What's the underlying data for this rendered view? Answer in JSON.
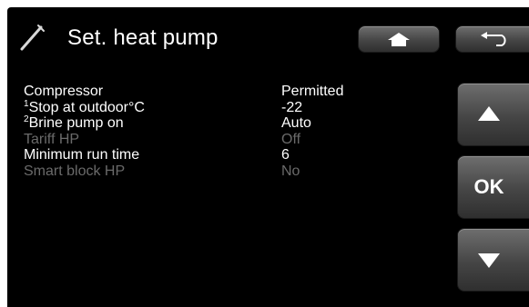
{
  "header": {
    "title": "Set. heat pump",
    "icon": "wrench-icon"
  },
  "nav_buttons": {
    "home_icon": "home-icon",
    "back_icon": "back-arrow-icon",
    "up_icon": "up-arrow-icon",
    "ok_label": "OK",
    "down_icon": "down-arrow-icon"
  },
  "settings": [
    {
      "sup": "",
      "label": "Compressor",
      "value": "Permitted",
      "enabled": true
    },
    {
      "sup": "1",
      "label": "Stop at outdoor°C",
      "value": "-22",
      "enabled": true
    },
    {
      "sup": "2",
      "label": "Brine pump on",
      "value": "Auto",
      "enabled": true
    },
    {
      "sup": "",
      "label": "Tariff HP",
      "value": "Off",
      "enabled": false
    },
    {
      "sup": "",
      "label": "Minimum run time",
      "value": "6",
      "enabled": true
    },
    {
      "sup": "",
      "label": "Smart block HP",
      "value": "No",
      "enabled": false
    }
  ],
  "colors": {
    "background": "#000000",
    "text_enabled": "#ffffff",
    "text_disabled": "#6a6a6a",
    "button": "#555555"
  }
}
